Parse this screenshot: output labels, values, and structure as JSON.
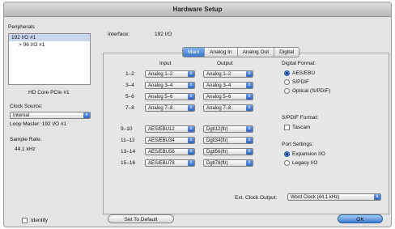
{
  "window": {
    "title": "Hardware Setup"
  },
  "peripherals": {
    "heading": "Peripherals",
    "items": [
      "192 I/O #1",
      "> 96 I/O #1"
    ],
    "card_label": "HD Core PCIe #1"
  },
  "clock": {
    "heading": "Clock Source:",
    "value": "Internal",
    "loop_master": "Loop Master: 192 I/O #1",
    "sample_rate_heading": "Sample Rate:",
    "sample_rate_value": "44.1 kHz"
  },
  "interface": {
    "label": "Interface:",
    "value": "192 I/O"
  },
  "tabs": [
    "Main",
    "Analog In",
    "Analog Out",
    "Digital"
  ],
  "io_table": {
    "input_header": "Input",
    "output_header": "Output",
    "rows": [
      {
        "ch": "1–2",
        "input": "Analog 1–2",
        "output": "Analog 1–2"
      },
      {
        "ch": "3–4",
        "input": "Analog 3–4",
        "output": "Analog 3–4"
      },
      {
        "ch": "5–6",
        "input": "Analog 5–6",
        "output": "Analog 5–6"
      },
      {
        "ch": "7–8",
        "input": "Analog 7–8",
        "output": "Analog 7–8"
      },
      {
        "ch": "9–10",
        "input": "AES/EBU12",
        "output": "Dgtl12(ftr)"
      },
      {
        "ch": "11–12",
        "input": "AES/EBU34",
        "output": "Dgtl34(ftr)"
      },
      {
        "ch": "13–14",
        "input": "AES/EBU56",
        "output": "Dgtl56(ftr)"
      },
      {
        "ch": "15–16",
        "input": "AES/EBU78",
        "output": "Dgtl78(ftr)"
      }
    ]
  },
  "digital_format": {
    "heading": "Digital Format:",
    "options": [
      "AES/EBU",
      "S/PDIF",
      "Optical (S/PDIF)"
    ],
    "selected": "AES/EBU"
  },
  "spdif_format": {
    "heading": "S/PDIF Format:",
    "tascam": "Tascam"
  },
  "port_settings": {
    "heading": "Port Settings:",
    "options": [
      "Expansion I/O",
      "Legacy I/O"
    ],
    "selected": "Expansion I/O"
  },
  "ext_clock": {
    "label": "Ext. Clock Output:",
    "value": "Word Clock (44.1 kHz)"
  },
  "footer": {
    "identify": "Identify",
    "set_default": "Set To Default",
    "ok": "OK"
  },
  "colors": {
    "accent": "#3c76cc",
    "selection": "#c8d6ee"
  }
}
